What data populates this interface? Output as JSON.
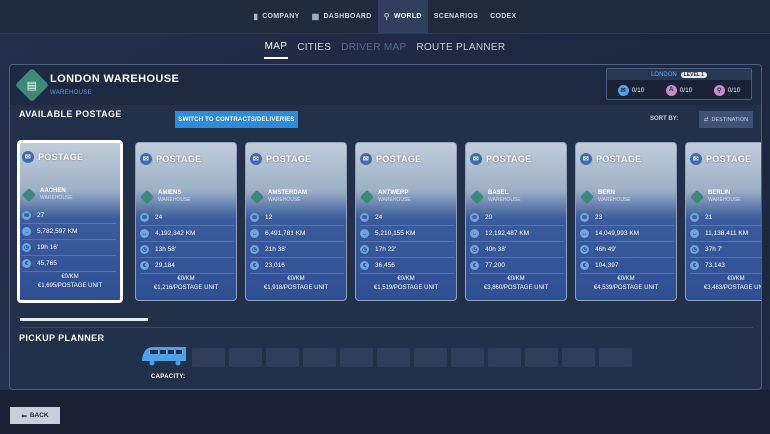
{
  "nav": {
    "items": [
      {
        "label": "COMPANY",
        "icon": "bars-icon",
        "active": false
      },
      {
        "label": "DASHBOARD",
        "icon": "grid-icon",
        "active": false
      },
      {
        "label": "WORLD",
        "icon": "pin-icon",
        "active": true
      },
      {
        "label": "SCENARIOS",
        "icon": "",
        "active": false
      },
      {
        "label": "CODEX",
        "icon": "",
        "active": false
      }
    ]
  },
  "subtabs": [
    {
      "label": "MAP",
      "state": "active"
    },
    {
      "label": "CITIES",
      "state": "normal"
    },
    {
      "label": "DRIVER MAP",
      "state": "disabled"
    },
    {
      "label": "ROUTE PLANNER",
      "state": "normal"
    }
  ],
  "warehouse": {
    "title": "LONDON WAREHOUSE",
    "subtitle": "WAREHOUSE"
  },
  "location": {
    "city": "LONDON",
    "level": "LEVEL 1",
    "stats": [
      {
        "icon": "postage-icon",
        "value": "0/10",
        "color": "#4fa3e8"
      },
      {
        "icon": "a-badge-icon",
        "value": "0/10",
        "color": "#c58ad6"
      },
      {
        "icon": "pin-badge-icon",
        "value": "0/10",
        "color": "#c58ad6"
      }
    ]
  },
  "available_postage": {
    "label": "AVAILABLE POSTAGE",
    "switch_label": "SWITCH TO CONTRACTS/DELIVERIES",
    "sort_label": "SORT BY:",
    "sort_value": "DESTINATION"
  },
  "cards": [
    {
      "title": "POSTAGE",
      "dest": "AACHEN",
      "dest_type": "WAREHOUSE",
      "count": "27",
      "distance": "5,782,597 KM",
      "time": "19h 16'",
      "money": "45,765",
      "price_km": "€0/KM",
      "price_unit": "€1,695/POSTAGE UNIT"
    },
    {
      "title": "POSTAGE",
      "dest": "AMIENS",
      "dest_type": "WAREHOUSE",
      "count": "24",
      "distance": "4,192,342 KM",
      "time": "13h 58'",
      "money": "29,184",
      "price_km": "€0/KM",
      "price_unit": "€1,216/POSTAGE UNIT"
    },
    {
      "title": "POSTAGE",
      "dest": "AMSTERDAM",
      "dest_type": "WAREHOUSE",
      "count": "12",
      "distance": "6,491,781 KM",
      "time": "21h 38'",
      "money": "23,016",
      "price_km": "€0/KM",
      "price_unit": "€1,918/POSTAGE UNIT"
    },
    {
      "title": "POSTAGE",
      "dest": "ANTWERP",
      "dest_type": "WAREHOUSE",
      "count": "24",
      "distance": "5,210,155 KM",
      "time": "17h 22'",
      "money": "36,456",
      "price_km": "€0/KM",
      "price_unit": "€1,519/POSTAGE UNIT"
    },
    {
      "title": "POSTAGE",
      "dest": "BASEL",
      "dest_type": "WAREHOUSE",
      "count": "20",
      "distance": "12,192,487 KM",
      "time": "40h 38'",
      "money": "77,200",
      "price_km": "€0/KM",
      "price_unit": "€3,860/POSTAGE UNIT"
    },
    {
      "title": "POSTAGE",
      "dest": "BERN",
      "dest_type": "WAREHOUSE",
      "count": "23",
      "distance": "14,049,993 KM",
      "time": "46h 49'",
      "money": "104,397",
      "price_km": "€0/KM",
      "price_unit": "€4,539/POSTAGE UNIT"
    },
    {
      "title": "POSTAGE",
      "dest": "BERLIN",
      "dest_type": "WAREHOUSE",
      "count": "21",
      "distance": "11,138,411 KM",
      "time": "37h 7'",
      "money": "73,143",
      "price_km": "€0/KM",
      "price_unit": "€3,483/POSTAGE UNIT"
    }
  ],
  "pickup": {
    "label": "PICKUP PLANNER",
    "capacity_label": "CAPACITY:",
    "slot_count": 12
  },
  "back_label": "BACK"
}
